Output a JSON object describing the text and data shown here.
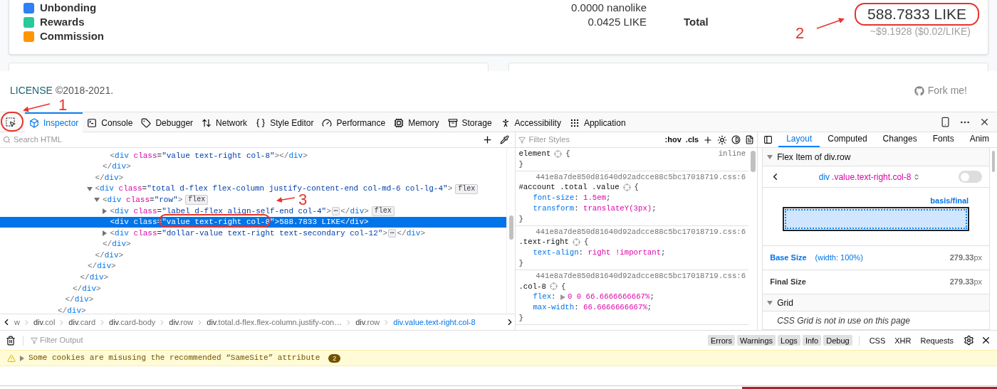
{
  "page": {
    "legend": [
      {
        "label": "Unbonding",
        "color": "#2f7ff5",
        "amount": "0.0000 nanolike"
      },
      {
        "label": "Rewards",
        "color": "#28c99a",
        "amount": "0.0425 LIKE"
      },
      {
        "label": "Commission",
        "color": "#ff9500"
      }
    ],
    "total_label": "Total",
    "total_value": "588.7833 LIKE",
    "total_dollar": "~$9.1928 ($0.02/LIKE)",
    "footer": {
      "license_link": "LICENSE",
      "copyright": "©2018-2021.",
      "fork_link": "Fork me!"
    }
  },
  "devtools": {
    "picker": {
      "selected": false
    },
    "tabs": [
      {
        "label": "Inspector",
        "selected": true
      },
      {
        "label": "Console",
        "selected": false
      },
      {
        "label": "Debugger",
        "selected": false
      },
      {
        "label": "Network",
        "selected": false
      },
      {
        "label": "Style Editor",
        "selected": false
      },
      {
        "label": "Performance",
        "selected": false
      },
      {
        "label": "Memory",
        "selected": false
      },
      {
        "label": "Storage",
        "selected": false
      },
      {
        "label": "Accessibility",
        "selected": false
      },
      {
        "label": "Application",
        "selected": false
      }
    ],
    "html_search": {
      "placeholder": "Search HTML"
    },
    "html_tree": [
      {
        "kind": "tail",
        "close": "</div>",
        "selected": false,
        "children": [
          {
            "kind": "tail",
            "close": "</div>",
            "selected": false,
            "children": [
              {
                "kind": "tail",
                "close": "</div>",
                "selected": false,
                "children": [
                  {
                    "kind": "tail",
                    "close": "</div>",
                    "selected": false,
                    "children": [
                      {
                        "kind": "tail",
                        "close": "</div>",
                        "selected": false,
                        "children": [
                          {
                            "kind": "tail",
                            "close": "</div>",
                            "selected": false,
                            "children": [
                              {
                                "kind": "tail",
                                "close": "</div>",
                                "selected": false,
                                "children": [
                                  {
                                    "kind": "element",
                                    "open": "<div class=\"value text-right col-8\">",
                                    "close": "</div>",
                                    "selected": false
                                  }
                                ]
                              }
                            ]
                          },
                          {
                            "kind": "element",
                            "open": "<div class=\"total d-flex flex-column justify-content-end col-md-6 col-lg-4\">",
                            "close": "</div>",
                            "badge": "flex",
                            "expanded": true,
                            "selected": false,
                            "children": [
                              {
                                "kind": "element",
                                "open": "<div class=\"row\">",
                                "close": "</div>",
                                "badge": "flex",
                                "expanded": true,
                                "selected": false,
                                "children": [
                                  {
                                    "kind": "element",
                                    "open": "<div class=\"label d-flex align-self-end col-4\">",
                                    "close": "</div>",
                                    "badge": "flex",
                                    "expanded": false,
                                    "hidden_marker": "⋯",
                                    "selected": false
                                  },
                                  {
                                    "kind": "element",
                                    "open": "<div class=\"value text-right col-8\">",
                                    "text": "588.7833 LIKE",
                                    "close": "</div>",
                                    "selected": true
                                  },
                                  {
                                    "kind": "element",
                                    "open": "<div class=\"dollar-value text-right text-secondary col-12\">",
                                    "close": "</div>",
                                    "expanded": false,
                                    "hidden_marker": "⋯",
                                    "selected": false
                                  }
                                ]
                              }
                            ]
                          }
                        ]
                      }
                    ]
                  }
                ]
              }
            ]
          }
        ]
      }
    ],
    "breadcrumbs": [
      {
        "classes": "w",
        "selected": false
      },
      {
        "tag": "div",
        "classes": ".col",
        "selected": false
      },
      {
        "tag": "div",
        "classes": ".card",
        "selected": false
      },
      {
        "tag": "div",
        "classes": ".card-body",
        "selected": false
      },
      {
        "tag": "div",
        "classes": ".row",
        "selected": false
      },
      {
        "tag": "div",
        "classes": ".total.d-flex.flex-column.justify-con…",
        "selected": false
      },
      {
        "tag": "div",
        "classes": ".row",
        "selected": false
      },
      {
        "tag": "div",
        "classes": ".value.text-right.col-8",
        "selected": true
      }
    ],
    "styles": {
      "filter_placeholder": "Filter Styles",
      "hov": ":hov",
      "cls": ".cls",
      "rules": [
        {
          "selector": "element",
          "open": "{",
          "close": "}",
          "origin": "inline"
        },
        {
          "source": "441e8a7de850d81640d92adcce88c5bc17018719.css:6",
          "selector": "#account .total .value",
          "open": "{",
          "close": "}",
          "declarations": [
            {
              "text": "font-size: 1.5em;",
              "expandable": false
            },
            {
              "text": "transform: translateY(3px);",
              "expandable": false
            }
          ]
        },
        {
          "source": "441e8a7de850d81640d92adcce88c5bc17018719.css:6",
          "selector": ".text-right",
          "open": "{",
          "close": "}",
          "declarations": [
            {
              "text": "text-align: right !important;",
              "expandable": false
            }
          ]
        },
        {
          "source": "441e8a7de850d81640d92adcce88c5bc17018719.css:6",
          "selector": ".col-8",
          "open": "{",
          "close": "}",
          "declarations": [
            {
              "text": "flex: 0 0 66.6666666667%;",
              "expandable": true
            },
            {
              "text": "max-width: 66.6666666667%;",
              "expandable": false
            }
          ]
        }
      ]
    },
    "sidebar_tabs": [
      {
        "label": "Layout",
        "selected": true
      },
      {
        "label": "Computed",
        "selected": false
      },
      {
        "label": "Changes",
        "selected": false
      },
      {
        "label": "Fonts",
        "selected": false
      },
      {
        "label": "Anim",
        "selected": false
      }
    ],
    "layout": {
      "flex_section": {
        "title": "Flex Item of div.row",
        "expanded": true
      },
      "item_tag": "div",
      "item_classes": ".value.text-right.col-8",
      "highlight_on": false,
      "diagram_label": "basis/final",
      "base_size": {
        "label": "Base Size",
        "note": "(width: 100%)",
        "value": "**279.33**px"
      },
      "final_size": {
        "label": "Final Size",
        "value": "**279.33**px"
      },
      "grid_section": {
        "title": "Grid",
        "expanded": true
      },
      "grid_note": "CSS Grid is not in use on this page"
    },
    "console": {
      "filter_placeholder": "Filter Output",
      "filters": [
        {
          "label": "Errors",
          "selected": true
        },
        {
          "label": "Warnings",
          "selected": true
        },
        {
          "label": "Logs",
          "selected": true
        },
        {
          "label": "Info",
          "selected": true
        },
        {
          "label": "Debug",
          "selected": true
        }
      ],
      "net_filters": [
        {
          "label": "CSS",
          "selected": false
        },
        {
          "label": "XHR",
          "selected": false
        },
        {
          "label": "Requests",
          "selected": false
        }
      ],
      "messages": [
        {
          "kind": "warning",
          "expanded": false,
          "text": "Some cookies are misusing the recommended “SameSite” attribute",
          "count": "2"
        }
      ]
    }
  },
  "annotations": [
    {
      "label": "1"
    },
    {
      "label": "2"
    },
    {
      "label": "3"
    }
  ]
}
